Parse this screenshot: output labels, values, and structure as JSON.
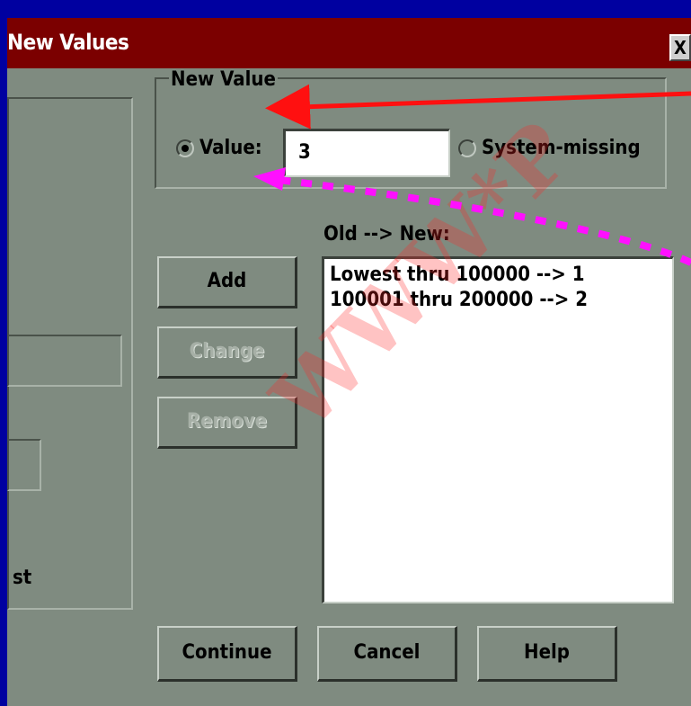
{
  "dialog": {
    "title": "New Values",
    "close_label": "X"
  },
  "new_value": {
    "legend": "New Value",
    "value_label": "Value:",
    "value_input": "3",
    "system_missing_label": "System-missing"
  },
  "buttons": {
    "add": "Add",
    "change": "Change",
    "remove": "Remove",
    "continue": "Continue",
    "cancel": "Cancel",
    "help": "Help"
  },
  "mapping": {
    "label": "Old --> New:",
    "items": [
      "Lowest thru 100000 --> 1",
      "100001 thru 200000 --> 2"
    ]
  },
  "left_panel": {
    "partial_label": "st"
  },
  "watermark": {
    "text": "WWW*P"
  },
  "colors": {
    "dialog_bg": "#7f8b80",
    "titlebar": "#7b0000",
    "annotation_red": "#ff1010",
    "annotation_magenta": "#ff10ff",
    "outer_bg": "#0000a0"
  }
}
